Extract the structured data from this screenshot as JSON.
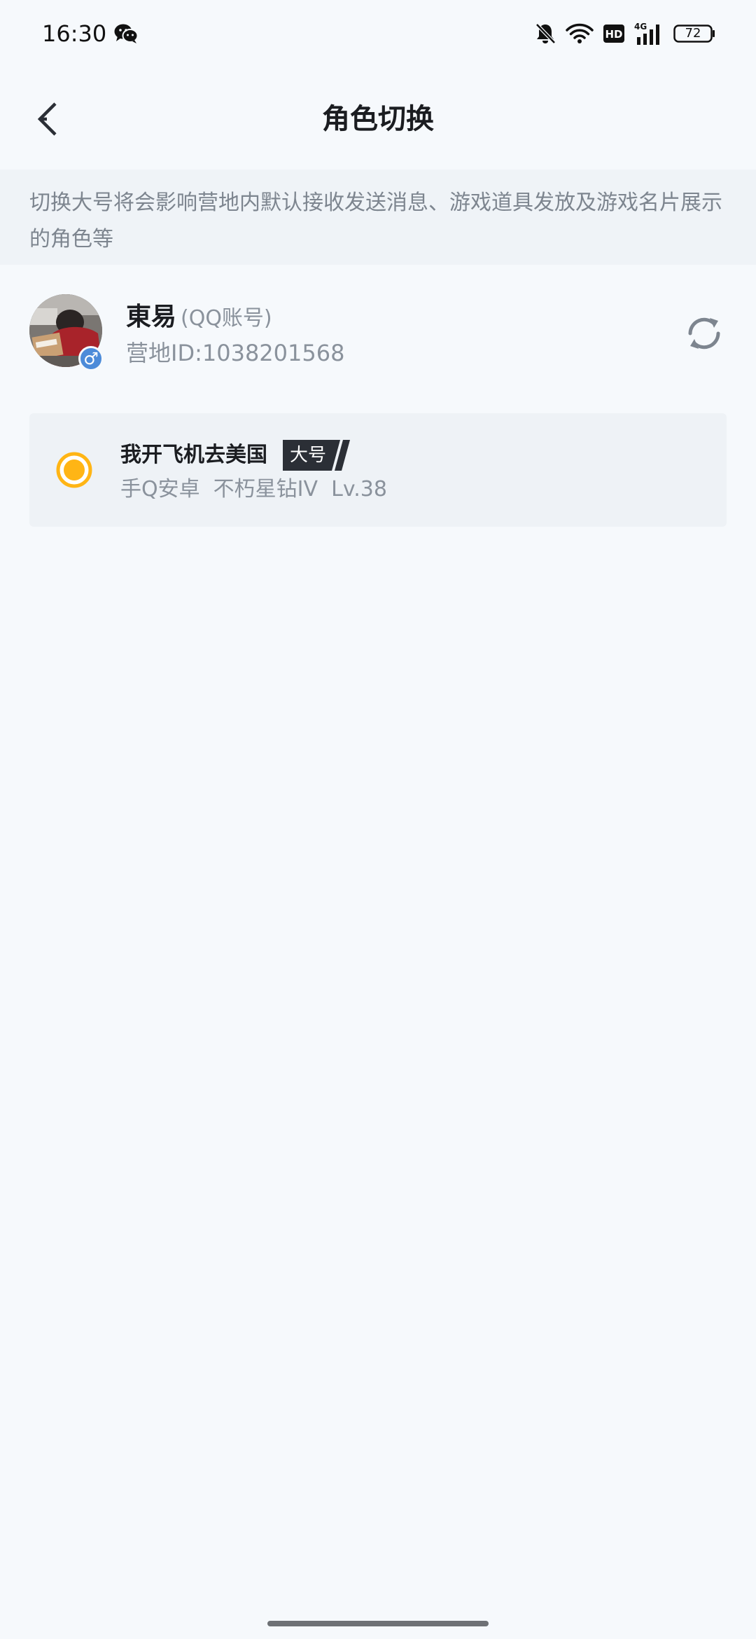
{
  "status_bar": {
    "time": "16:30",
    "wechat_icon": "wechat-icon",
    "mute_icon": "bell-muted-icon",
    "wifi_icon": "wifi-icon",
    "hd_label": "HD",
    "network_label": "4G",
    "battery": "72"
  },
  "header": {
    "title": "角色切换",
    "back_icon": "chevron-left-icon"
  },
  "notice": {
    "text": "切换大号将会影响营地内默认接收发送消息、游戏道具发放及游戏名片展示的角色等"
  },
  "account": {
    "name": "東易",
    "type": "(QQ账号)",
    "camp_id": "营地ID:1038201568",
    "gender_symbol": "♂",
    "refresh_icon": "refresh-icon"
  },
  "role": {
    "name": "我开飞机去美国",
    "badge": "大号",
    "meta": "手Q安卓  不朽星钻IV  Lv.38",
    "selected": true
  },
  "colors": {
    "background": "#f6f9fc",
    "notice_background": "#eff3f7",
    "card_background": "#eef2f6",
    "accent": "#ffb515",
    "badge": "#2b2f36",
    "secondary_text": "#8a929c"
  }
}
